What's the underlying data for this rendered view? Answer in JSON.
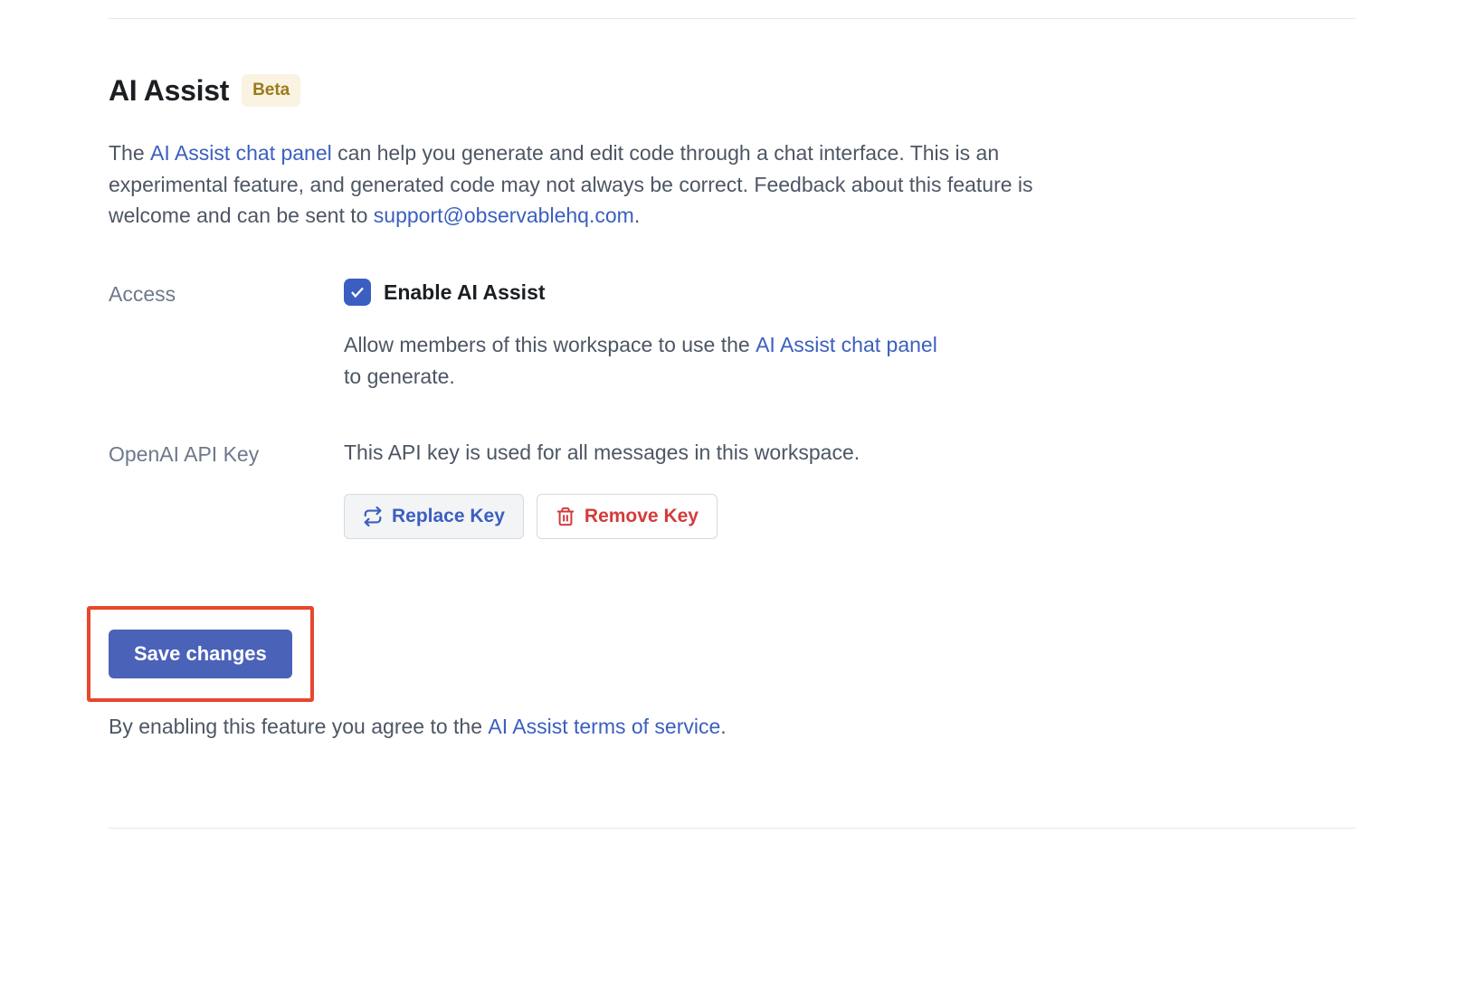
{
  "section": {
    "title": "AI Assist",
    "badge": "Beta"
  },
  "description": {
    "prefix": "The ",
    "link1_text": "AI Assist chat panel",
    "middle": " can help you generate and edit code through a chat interface. This is an experimental feature, and generated code may not always be correct. Feedback about this feature is welcome and can be sent to ",
    "email_text": "support@observablehq.com",
    "suffix": "."
  },
  "access": {
    "label": "Access",
    "checkbox_label": "Enable AI Assist",
    "hint_prefix": "Allow members of this workspace to use the ",
    "hint_link": "AI Assist chat panel",
    "hint_suffix": " to generate."
  },
  "api_key": {
    "label": "OpenAI API Key",
    "hint": "This API key is used for all messages in this workspace.",
    "replace_button": "Replace Key",
    "remove_button": "Remove Key"
  },
  "save_button": "Save changes",
  "terms": {
    "prefix": "By enabling this feature you agree to the ",
    "link_text": "AI Assist terms of service",
    "suffix": "."
  }
}
